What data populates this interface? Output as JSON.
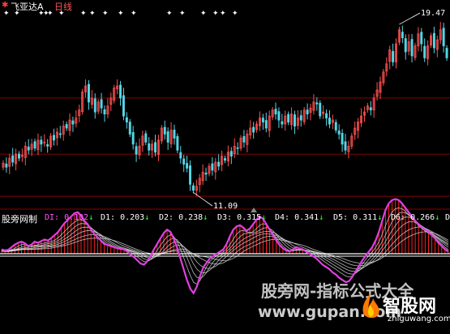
{
  "header": {
    "title": "飞亚达A",
    "period": "日线"
  },
  "indicator_bar": {
    "name": "股旁网制",
    "items": [
      {
        "label": "DI:",
        "value": "0.102",
        "arrow": "↓",
        "color": "#ff55ff"
      },
      {
        "label": "D1:",
        "value": "0.203",
        "arrow": "↓",
        "color": "#ffffff"
      },
      {
        "label": "D2:",
        "value": "0.238",
        "arrow": "↓",
        "color": "#ffffff"
      },
      {
        "label": "D3:",
        "value": "0.315",
        "arrow": "↓",
        "color": "#ffffff"
      },
      {
        "label": "D4:",
        "value": "0.341",
        "arrow": "↓",
        "color": "#ffffff"
      },
      {
        "label": "D5:",
        "value": "0.311",
        "arrow": "↓",
        "color": "#ffffff"
      },
      {
        "label": "D6:",
        "value": "0.266",
        "arrow": "↓",
        "color": "#ffffff"
      },
      {
        "label": "D",
        "value": "",
        "arrow": "",
        "color": "#ffffff"
      }
    ]
  },
  "price_annotations": {
    "high": "19.47",
    "low": "11.09"
  },
  "watermark": {
    "line1": "股旁网-指标公式大全",
    "url": "www.gupan.com",
    "brand": "智股网",
    "brand_url": "zhiguwang.com"
  },
  "colors": {
    "up": "#ff5050",
    "down": "#54d6e6",
    "grid": "#8b0000",
    "di_line": "#e040e0",
    "d_lines": "#d8d8d8",
    "bars": "#ff2020",
    "baseline": "#ffffff"
  },
  "chart_data": [
    {
      "type": "candlestick",
      "title": "飞亚达A 日线",
      "ylim": [
        10.5,
        20.2
      ],
      "annotations": [
        {
          "label": "19.47",
          "index": 125,
          "value": 19.47
        },
        {
          "label": "11.09",
          "index": 60,
          "value": 11.09
        }
      ],
      "close": [
        12.55,
        12.35,
        12.8,
        12.6,
        13.0,
        12.8,
        12.95,
        13.4,
        13.2,
        13.5,
        13.3,
        13.7,
        13.5,
        13.6,
        13.4,
        13.9,
        13.7,
        14.1,
        14.0,
        14.4,
        14.3,
        14.7,
        14.5,
        14.8,
        15.2,
        16.1,
        16.4,
        15.6,
        15.8,
        15.1,
        15.6,
        15.3,
        15.0,
        15.4,
        15.8,
        16.3,
        16.4,
        15.8,
        14.9,
        14.6,
        14.0,
        13.5,
        13.0,
        13.4,
        13.9,
        13.6,
        13.2,
        13.5,
        13.1,
        13.7,
        14.3,
        14.0,
        13.6,
        14.2,
        13.8,
        13.2,
        12.8,
        12.5,
        12.3,
        11.5,
        11.2,
        11.4,
        11.8,
        12.1,
        12.0,
        12.4,
        12.2,
        12.6,
        12.4,
        12.9,
        12.7,
        13.1,
        12.9,
        13.4,
        13.3,
        13.8,
        13.6,
        14.0,
        14.3,
        14.1,
        14.5,
        14.8,
        14.6,
        14.3,
        14.9,
        15.2,
        15.0,
        14.7,
        14.5,
        14.9,
        14.6,
        15.0,
        14.4,
        14.8,
        14.7,
        15.2,
        15.0,
        15.3,
        15.6,
        15.5,
        14.9,
        15.1,
        14.8,
        14.5,
        14.7,
        14.2,
        14.0,
        13.5,
        13.2,
        13.4,
        13.9,
        14.3,
        14.6,
        14.9,
        15.1,
        15.4,
        15.2,
        15.8,
        16.2,
        16.6,
        17.1,
        17.5,
        18.2,
        17.6,
        18.5,
        19.2,
        18.8,
        18.1,
        18.6,
        17.9,
        18.4,
        19.0,
        18.5,
        17.8,
        18.4,
        18.9,
        18.3,
        18.7,
        19.2,
        18.4,
        17.8
      ],
      "high_low_spread": "approx",
      "gridlines_y": [
        15.8,
        13.0,
        10.9
      ]
    },
    {
      "type": "line",
      "title": "股旁网制",
      "series": [
        {
          "name": "DI",
          "last": 0.102
        },
        {
          "name": "D1",
          "last": 0.203
        },
        {
          "name": "D2",
          "last": 0.238
        },
        {
          "name": "D3",
          "last": 0.315
        },
        {
          "name": "D4",
          "last": 0.341
        },
        {
          "name": "D5",
          "last": 0.311
        },
        {
          "name": "D6",
          "last": 0.266
        }
      ],
      "di_values": [
        0.2,
        0.15,
        0.18,
        0.3,
        0.42,
        0.5,
        0.55,
        0.48,
        0.35,
        0.42,
        0.55,
        0.5,
        0.58,
        0.65,
        0.6,
        0.72,
        0.85,
        0.98,
        1.2,
        1.4,
        1.55,
        1.7,
        1.85,
        1.9,
        1.75,
        1.5,
        1.35,
        1.1,
        0.9,
        0.75,
        0.6,
        0.45,
        0.4,
        0.35,
        0.3,
        0.25,
        0.22,
        0.2,
        0.1,
        -0.05,
        -0.15,
        -0.3,
        -0.45,
        -0.5,
        -0.35,
        -0.1,
        0.2,
        0.45,
        0.7,
        0.95,
        1.1,
        1.0,
        0.7,
        0.3,
        -0.2,
        -0.7,
        -1.2,
        -1.6,
        -1.8,
        -1.5,
        -1.0,
        -0.6,
        -0.4,
        -0.2,
        -0.1,
        0.0,
        0.1,
        0.2,
        0.45,
        0.8,
        1.1,
        1.25,
        1.3,
        1.2,
        1.05,
        1.15,
        1.35,
        1.55,
        1.7,
        1.6,
        1.35,
        1.1,
        0.85,
        0.6,
        0.4,
        0.25,
        0.15,
        0.1,
        0.2,
        0.3,
        0.25,
        0.2,
        0.1,
        0.0,
        -0.1,
        -0.2,
        -0.35,
        -0.5,
        -0.6,
        -0.7,
        -0.85,
        -0.95,
        -1.1,
        -1.2,
        -1.3,
        -1.25,
        -1.05,
        -0.8,
        -0.55,
        -0.3,
        -0.1,
        0.1,
        0.3,
        0.6,
        1.0,
        1.5,
        2.0,
        2.3,
        2.45,
        2.5,
        2.45,
        2.3,
        2.1,
        1.9,
        1.7,
        1.5,
        1.35,
        1.2,
        1.1,
        1.0,
        0.85,
        0.7,
        0.5,
        0.35,
        0.2,
        0.1
      ],
      "baseline": 0
    }
  ]
}
